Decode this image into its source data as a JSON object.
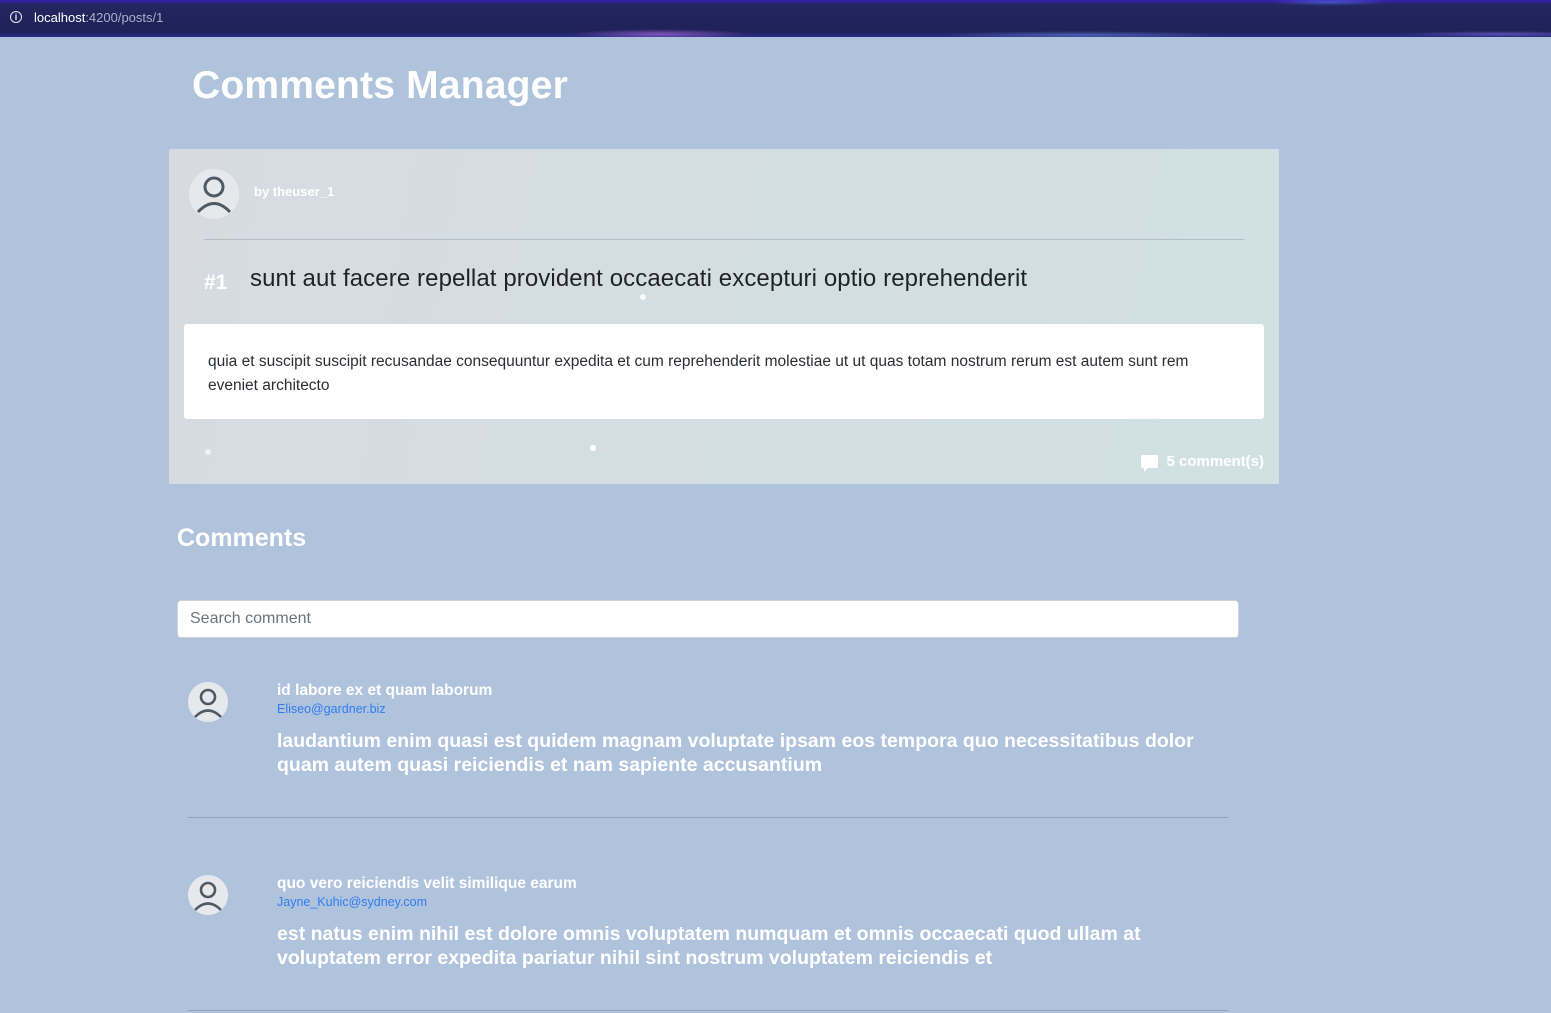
{
  "browser": {
    "url_host": "localhost",
    "url_path": ":4200/posts/1",
    "info_icon": "info-icon"
  },
  "header": {
    "title": "Comments Manager"
  },
  "post": {
    "author": "by theuser_1",
    "number": "#1",
    "title": "sunt aut facere repellat provident occaecati excepturi optio reprehenderit",
    "body": "quia et suscipit suscipit recusandae consequuntur expedita et cum reprehenderit molestiae ut ut quas totam nostrum rerum est autem sunt rem eveniet architecto",
    "comment_count": "5 comment(s)",
    "comment_icon": "chat-bubble-icon",
    "avatar_icon": "user-avatar-icon"
  },
  "comments_section": {
    "heading": "Comments",
    "search_placeholder": "Search comment",
    "search_value": ""
  },
  "comments": [
    {
      "name": "id labore ex et quam laborum",
      "email": "Eliseo@gardner.biz",
      "body": "laudantium enim quasi est quidem magnam voluptate ipsam eos tempora quo necessitatibus dolor quam autem quasi reiciendis et nam sapiente accusantium"
    },
    {
      "name": "quo vero reiciendis velit similique earum",
      "email": "Jayne_Kuhic@sydney.com",
      "body": "est natus enim nihil est dolore omnis voluptatem numquam et omnis occaecati quod ullam at voluptatem error expedita pariatur nihil sint nostrum voluptatem reiciendis et"
    }
  ],
  "colors": {
    "page_background": "#afc3dd",
    "email_link": "#2f7cf0",
    "post_title": "#1f2328"
  }
}
